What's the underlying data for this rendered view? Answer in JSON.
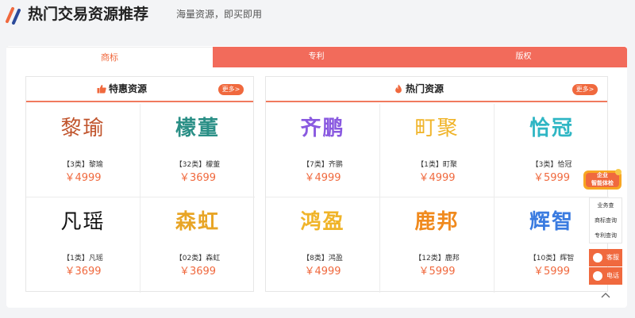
{
  "header": {
    "title": "热门交易资源推荐",
    "subtitle": "海量资源，即买即用"
  },
  "tabs": [
    {
      "label": "商标"
    },
    {
      "label": "专利"
    },
    {
      "label": "版权"
    }
  ],
  "panels": {
    "discount": {
      "title": "特惠资源",
      "more": "更多>",
      "items": [
        {
          "logo": "黎瑜",
          "name": "【3类】黎瑜",
          "price": "￥4999",
          "color": "#c0532b"
        },
        {
          "logo": "檬董",
          "name": "【32类】檬董",
          "price": "￥3699",
          "color": "#2a8f86"
        },
        {
          "logo": "凡瑶",
          "name": "【1类】凡瑶",
          "price": "￥3699",
          "color": "#111111"
        },
        {
          "logo": "森虹",
          "name": "【02类】森虹",
          "price": "￥3699",
          "color": "#e8a526"
        }
      ]
    },
    "hot": {
      "title": "热门资源",
      "more": "更多>",
      "items": [
        {
          "logo": "齐鹏",
          "name": "【7类】齐鹏",
          "price": "￥4999",
          "color": "#8a5ae0"
        },
        {
          "logo": "町聚",
          "name": "【1类】町聚",
          "price": "￥4999",
          "color": "#f0b429"
        },
        {
          "logo": "恰冠",
          "name": "【3类】恰冠",
          "price": "￥5999",
          "color": "#2fb6c4"
        },
        {
          "logo": "鸿盈",
          "name": "【8类】鸿盈",
          "price": "￥4999",
          "color": "#f0b429"
        },
        {
          "logo": "鹿邦",
          "name": "【12类】鹿邦",
          "price": "￥5999",
          "color": "#f08a1e"
        },
        {
          "logo": "辉智",
          "name": "【10类】辉智",
          "price": "￥5999",
          "color": "#3a7be0"
        }
      ]
    }
  },
  "side": {
    "badge_line1": "企业",
    "badge_line2": "智能体检",
    "menu": [
      "业务查",
      "商标查询",
      "专利查询"
    ],
    "service": "客服",
    "phone": "电话"
  },
  "colors": {
    "accent": "#f0693e",
    "tab_bg": "#f26b5b"
  }
}
